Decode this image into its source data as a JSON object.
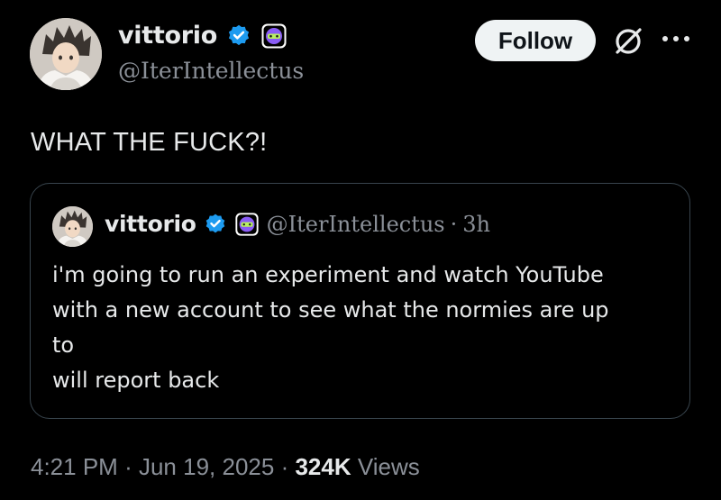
{
  "author": {
    "display_name": "vittorio",
    "handle": "@IterIntellectus",
    "avatar": "anime-character-avatar",
    "verified_icon": "verified-badge-icon",
    "affiliate_icon": "affiliate-badge-icon"
  },
  "actions": {
    "follow_label": "Follow",
    "grok_icon": "grok-icon",
    "more_icon": "more-options-icon"
  },
  "tweet": {
    "text": "WHAT THE FUCK?!"
  },
  "quote": {
    "display_name": "vittorio",
    "handle": "@IterIntellectus",
    "separator": "·",
    "time": "3h",
    "lines": [
      "i'm going to run an experiment and watch YouTube",
      "with a new account to see what the normies are up",
      "to",
      "will report back"
    ]
  },
  "meta": {
    "time": "4:21 PM",
    "sep1": "·",
    "date": "Jun 19, 2025",
    "sep2": "·",
    "views_count": "324K",
    "views_label": "Views"
  },
  "colors": {
    "background": "#000000",
    "text_primary": "#e7e9ea",
    "text_secondary": "#8b9098",
    "verified_blue": "#1d9bf0",
    "badge_purple": "#8a5cf6",
    "follow_bg": "#eff3f4",
    "border": "#38444d"
  }
}
